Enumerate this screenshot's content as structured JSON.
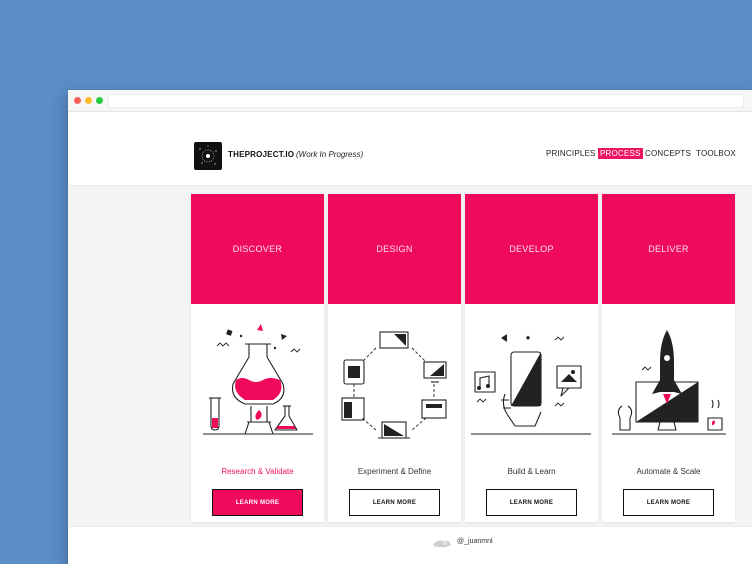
{
  "app": {
    "brand": "THEPROJECT.IO",
    "tagline": "(Work In Progress)"
  },
  "nav": {
    "items": [
      "PRINCIPLES",
      "PROCESS",
      "CONCEPTS",
      "TOOLBOX"
    ],
    "active": "PROCESS"
  },
  "colors": {
    "accent": "#ef0a5c",
    "background": "#5b8dc8"
  },
  "cards": [
    {
      "title": "DISCOVER",
      "subtitle": "Research & Validate",
      "button": "LEARN MORE",
      "icon": "lab-flasks-icon"
    },
    {
      "title": "DESIGN",
      "subtitle": "Experiment & Define",
      "button": "LEARN MORE",
      "icon": "devices-cycle-icon"
    },
    {
      "title": "DEVELOP",
      "subtitle": "Build & Learn",
      "button": "LEARN MORE",
      "icon": "hand-phone-icon"
    },
    {
      "title": "DELIVER",
      "subtitle": "Automate & Scale",
      "button": "LEARN MORE",
      "icon": "rocket-monitor-icon"
    }
  ],
  "footer": {
    "credit": "@_juanmnl"
  }
}
